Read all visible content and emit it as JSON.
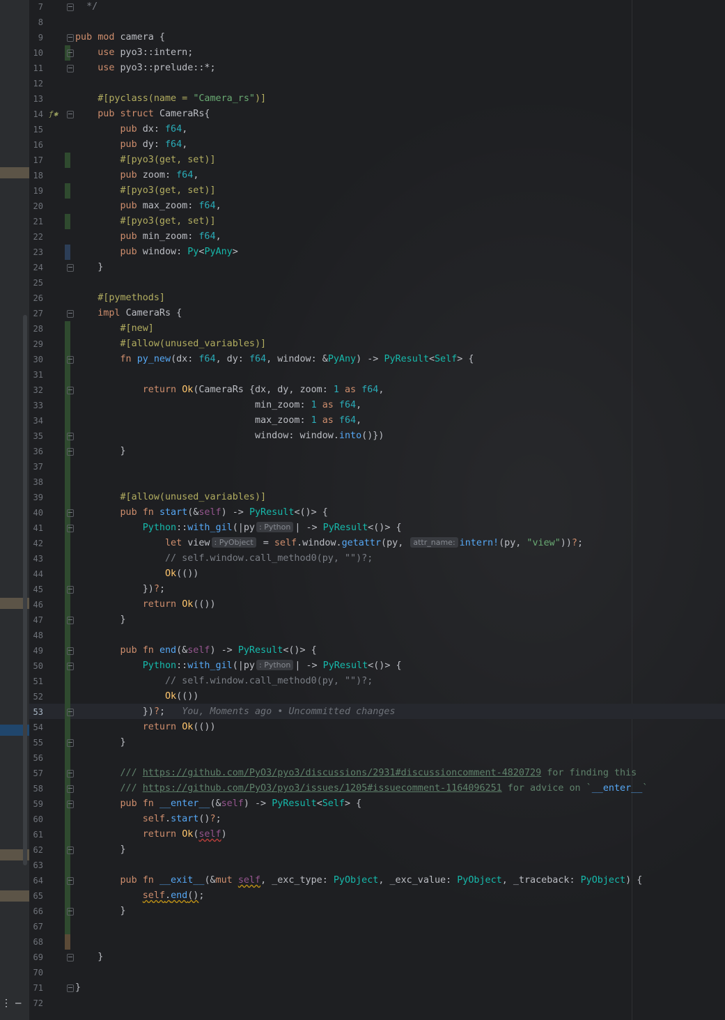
{
  "editor": {
    "language": "Rust",
    "current_line": 53,
    "colors": {
      "background": "#1e1f22",
      "keyword": "#cf8e6d",
      "type": "#2aacb8",
      "function": "#56a8f5",
      "string": "#6aab73",
      "attribute": "#b3ae60",
      "comment": "#7a7e85",
      "self": "#94558d",
      "added_line_marker": "#2f4a2f",
      "modified_line_marker": "#2c3e57"
    },
    "lines": [
      {
        "n": "7",
        "text": "  */"
      },
      {
        "n": "8",
        "text": ""
      },
      {
        "n": "9",
        "text": "pub mod camera {"
      },
      {
        "n": "10",
        "text": "    use pyo3::intern;"
      },
      {
        "n": "11",
        "text": "    use pyo3::prelude::*;"
      },
      {
        "n": "12",
        "text": ""
      },
      {
        "n": "13",
        "text": "    #[pyclass(name = \"Camera_rs\")]"
      },
      {
        "n": "14",
        "text": "    pub struct CameraRs{"
      },
      {
        "n": "15",
        "text": "        pub dx: f64,"
      },
      {
        "n": "16",
        "text": "        pub dy: f64,"
      },
      {
        "n": "17",
        "text": "        #[pyo3(get, set)]"
      },
      {
        "n": "18",
        "text": "        pub zoom: f64,"
      },
      {
        "n": "19",
        "text": "        #[pyo3(get, set)]"
      },
      {
        "n": "20",
        "text": "        pub max_zoom: f64,"
      },
      {
        "n": "21",
        "text": "        #[pyo3(get, set)]"
      },
      {
        "n": "22",
        "text": "        pub min_zoom: f64,"
      },
      {
        "n": "23",
        "text": "        pub window: Py<PyAny>"
      },
      {
        "n": "24",
        "text": "    }"
      },
      {
        "n": "25",
        "text": ""
      },
      {
        "n": "26",
        "text": "    #[pymethods]"
      },
      {
        "n": "27",
        "text": "    impl CameraRs {"
      },
      {
        "n": "28",
        "text": "        #[new]"
      },
      {
        "n": "29",
        "text": "        #[allow(unused_variables)]"
      },
      {
        "n": "30",
        "text": "        fn py_new(dx: f64, dy: f64, window: &PyAny) -> PyResult<Self> {"
      },
      {
        "n": "31",
        "text": ""
      },
      {
        "n": "32",
        "text": "            return Ok(CameraRs {dx, dy, zoom: 1 as f64,"
      },
      {
        "n": "33",
        "text": "                                min_zoom: 1 as f64,"
      },
      {
        "n": "34",
        "text": "                                max_zoom: 1 as f64,"
      },
      {
        "n": "35",
        "text": "                                window: window.into()})"
      },
      {
        "n": "36",
        "text": "        }"
      },
      {
        "n": "37",
        "text": ""
      },
      {
        "n": "38",
        "text": ""
      },
      {
        "n": "39",
        "text": "        #[allow(unused_variables)]"
      },
      {
        "n": "40",
        "text": "        pub fn start(&self) -> PyResult<()> {"
      },
      {
        "n": "41",
        "text": "            Python::with_gil(|py| -> PyResult<()> {"
      },
      {
        "n": "42",
        "text": "                let view = self.window.getattr(py, intern!(py, \"view\"))?;"
      },
      {
        "n": "43",
        "text": "                // self.window.call_method0(py, \"\")?;"
      },
      {
        "n": "44",
        "text": "                Ok(())"
      },
      {
        "n": "45",
        "text": "            })?;"
      },
      {
        "n": "46",
        "text": "            return Ok(())"
      },
      {
        "n": "47",
        "text": "        }"
      },
      {
        "n": "48",
        "text": ""
      },
      {
        "n": "49",
        "text": "        pub fn end(&self) -> PyResult<()> {"
      },
      {
        "n": "50",
        "text": "            Python::with_gil(|py| -> PyResult<()> {"
      },
      {
        "n": "51",
        "text": "                // self.window.call_method0(py, \"\")?;"
      },
      {
        "n": "52",
        "text": "                Ok(())"
      },
      {
        "n": "53",
        "text": "            })?;"
      },
      {
        "n": "54",
        "text": "            return Ok(())"
      },
      {
        "n": "55",
        "text": "        }"
      },
      {
        "n": "56",
        "text": ""
      },
      {
        "n": "57",
        "text": "        /// https://github.com/PyO3/pyo3/discussions/2931#discussioncomment-4820729 for finding this"
      },
      {
        "n": "58",
        "text": "        /// https://github.com/PyO3/pyo3/issues/1205#issuecomment-1164096251 for advice on `__enter__`"
      },
      {
        "n": "59",
        "text": "        pub fn __enter__(&self) -> PyResult<Self> {"
      },
      {
        "n": "60",
        "text": "            self.start()?;"
      },
      {
        "n": "61",
        "text": "            return Ok(self)"
      },
      {
        "n": "62",
        "text": "        }"
      },
      {
        "n": "63",
        "text": ""
      },
      {
        "n": "64",
        "text": "        pub fn __exit__(&mut self, _exc_type: PyObject, _exc_value: PyObject, _traceback: PyObject) {"
      },
      {
        "n": "65",
        "text": "            self.end();"
      },
      {
        "n": "66",
        "text": "        }"
      },
      {
        "n": "67",
        "text": ""
      },
      {
        "n": "68",
        "text": ""
      },
      {
        "n": "69",
        "text": "    }"
      },
      {
        "n": "70",
        "text": ""
      },
      {
        "n": "71",
        "text": "}"
      },
      {
        "n": "72",
        "text": ""
      }
    ],
    "inlay_hints": {
      "py_type_41": ": Python",
      "view_type_42": ": PyObject",
      "attr_name_42": "attr_name:",
      "py_type_50": ": Python"
    },
    "blame_annotation": "You, Moments ago • Uncommitted changes",
    "gutter_icon_line_14": "implemented-trait-icon"
  }
}
